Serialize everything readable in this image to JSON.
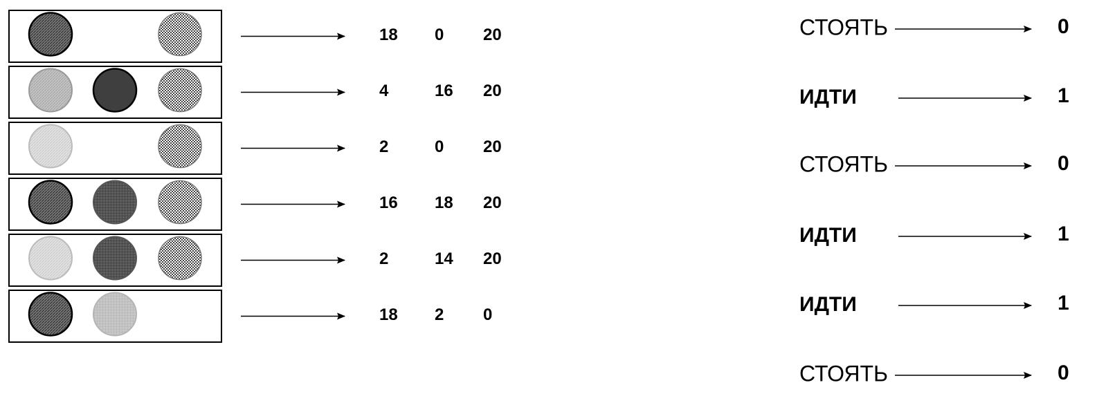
{
  "rows": [
    {
      "lights": [
        "dark",
        "none",
        "checker"
      ],
      "values": [
        "18",
        "0",
        "20"
      ]
    },
    {
      "lights": [
        "light",
        "black",
        "checker"
      ],
      "values": [
        "4",
        "16",
        "20"
      ]
    },
    {
      "lights": [
        "pale",
        "none",
        "checker"
      ],
      "values": [
        "2",
        "0",
        "20"
      ]
    },
    {
      "lights": [
        "dark",
        "grid",
        "checker"
      ],
      "values": [
        "16",
        "18",
        "20"
      ]
    },
    {
      "lights": [
        "pale",
        "grid",
        "checker"
      ],
      "values": [
        "2",
        "14",
        "20"
      ]
    },
    {
      "lights": [
        "dark",
        "lightgrid",
        "none"
      ],
      "values": [
        "18",
        "2",
        "0"
      ]
    }
  ],
  "decisions": [
    {
      "label": "СТОЯТЬ",
      "output": "0",
      "bold": false
    },
    {
      "label": "ИДТИ",
      "output": "1",
      "bold": true
    },
    {
      "label": "СТОЯТЬ",
      "output": "0",
      "bold": false
    },
    {
      "label": "ИДТИ",
      "output": "1",
      "bold": true
    },
    {
      "label": "ИДТИ",
      "output": "1",
      "bold": true
    },
    {
      "label": "СТОЯТЬ",
      "output": "0",
      "bold": false
    }
  ]
}
